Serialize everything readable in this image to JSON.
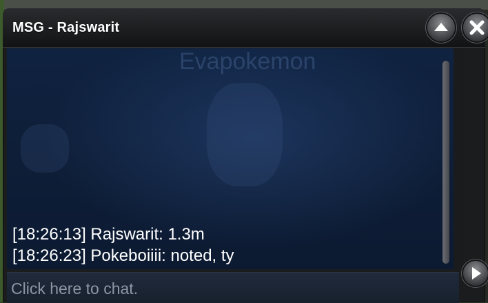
{
  "window": {
    "title": "MSG - Rajswarit"
  },
  "background": {
    "faint_text": "Evapokemon"
  },
  "messages": [
    {
      "text": "[18:26:13] Rajswarit: 1.3m"
    },
    {
      "text": "[18:26:23] Pokeboiiii: noted, ty"
    }
  ],
  "input": {
    "placeholder": "Click here to chat."
  },
  "icons": {
    "minimize": "chevron-up-icon",
    "close": "close-icon",
    "send": "play-arrow-icon"
  }
}
